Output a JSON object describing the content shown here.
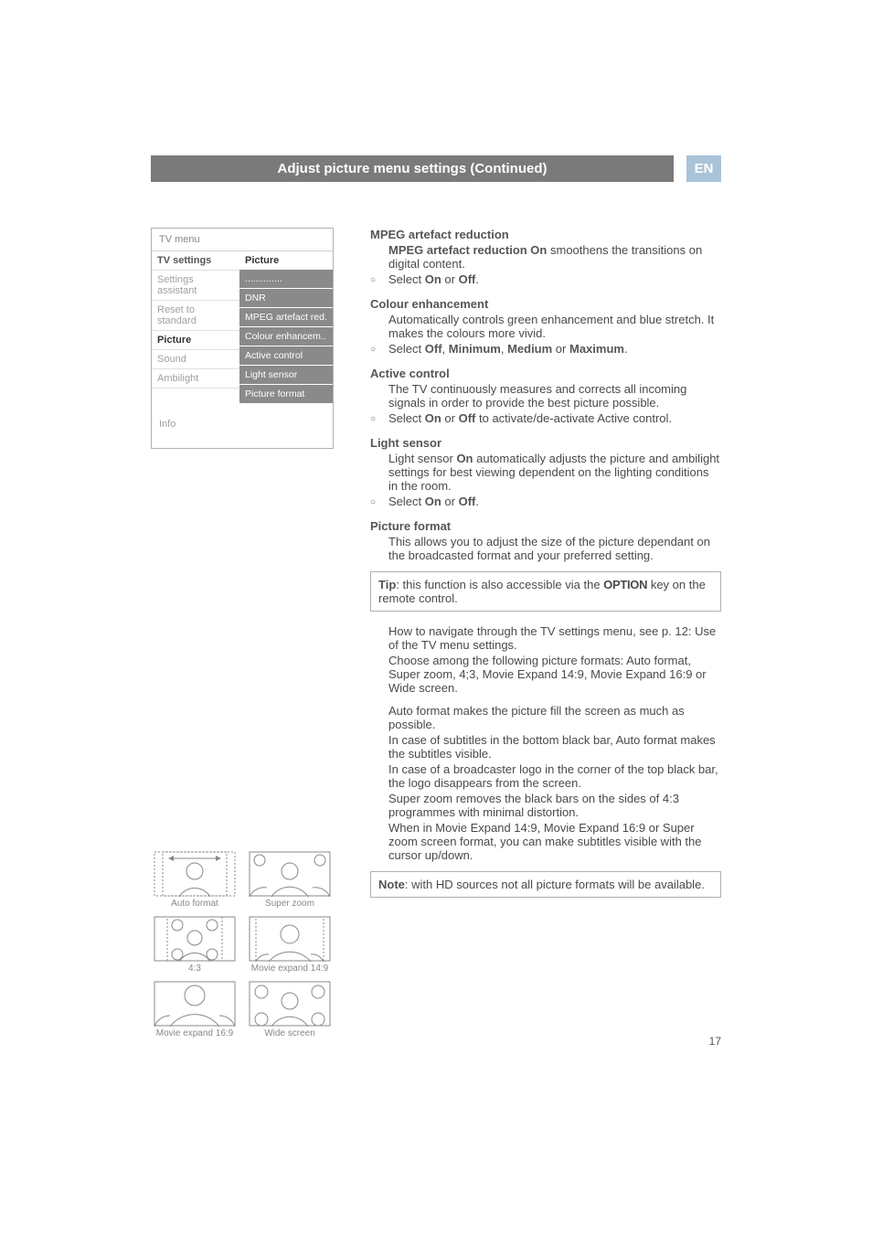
{
  "header": {
    "title": "Adjust picture menu settings  (Continued)",
    "lang": "EN"
  },
  "tvmenu": {
    "title": "TV menu",
    "left": {
      "tv_settings": "TV settings",
      "settings_assistant": "Settings assistant",
      "reset_to_standard": "Reset to standard",
      "picture": "Picture",
      "sound": "Sound",
      "ambilight": "Ambilight"
    },
    "right": {
      "heading": "Picture",
      "dots": "..............",
      "dnr": "DNR",
      "mpeg": "MPEG artefact red.",
      "colour": "Colour enhancem..",
      "active": "Active control",
      "light": "Light sensor",
      "format": "Picture format"
    },
    "info": "Info"
  },
  "formats": {
    "auto": "Auto format",
    "superzoom": "Super zoom",
    "four_three": "4:3",
    "me149": "Movie expand 14:9",
    "me169": "Movie expand 16:9",
    "wide": "Wide screen"
  },
  "sections": {
    "mpeg": {
      "title": "MPEG artefact reduction",
      "body1a": "MPEG artefact reduction On",
      "body1b": " smoothens the transitions on digital content.",
      "bullet_a": "Select ",
      "bullet_b": "On",
      "bullet_c": " or ",
      "bullet_d": "Off",
      "bullet_e": "."
    },
    "colour": {
      "title": "Colour enhancement",
      "body": "Automatically controls green enhancement and blue stretch. It makes the colours more vivid.",
      "bullet_a": "Select ",
      "bullet_b": "Off",
      "bullet_c": ", ",
      "bullet_d": "Minimum",
      "bullet_e": ", ",
      "bullet_f": "Medium",
      "bullet_g": " or ",
      "bullet_h": "Maximum",
      "bullet_i": "."
    },
    "active": {
      "title": "Active control",
      "body": "The TV continuously measures and corrects all incoming signals in order to provide the best picture possible.",
      "bullet_a": "Select ",
      "bullet_b": "On",
      "bullet_c": " or ",
      "bullet_d": "Off",
      "bullet_e": " to activate/de-activate Active control."
    },
    "light": {
      "title": "Light sensor",
      "body_a": "Light sensor ",
      "body_b": "On",
      "body_c": " automatically adjusts the picture and ambilight settings for best viewing dependent on the lighting conditions in the room.",
      "bullet_a": "Select ",
      "bullet_b": "On",
      "bullet_c": " or ",
      "bullet_d": "Off",
      "bullet_e": "."
    },
    "picfmt": {
      "title": "Picture format",
      "body1": "This allows you to adjust the size of the picture dependant on the broadcasted format and your preferred setting.",
      "tip_a": "Tip",
      "tip_b": ": this function is also accessible via the ",
      "tip_c": "OPTION",
      "tip_d": " key on the remote control.",
      "p2": "How to navigate through the TV settings menu, see p. 12: Use of the TV menu settings.",
      "p3": "Choose among the following picture formats: Auto format, Super zoom, 4;3, Movie Expand 14:9, Movie Expand 16:9 or Wide screen.",
      "p4": "Auto format makes the picture fill the screen as much as possible.",
      "p5": "In case of subtitles in the bottom black bar, Auto format makes the subtitles visible.",
      "p6": "In case of a broadcaster logo in the corner of the top black bar, the logo disappears from the screen.",
      "p7": "Super zoom removes the black bars on the sides of 4:3 programmes with minimal distortion.",
      "p8": "When in Movie Expand 14:9, Movie Expand 16:9 or Super zoom screen format, you can make subtitles visible with the cursor up/down.",
      "note_a": "Note",
      "note_b": ": with HD sources not all picture formats will be available."
    }
  },
  "page_number": "17"
}
